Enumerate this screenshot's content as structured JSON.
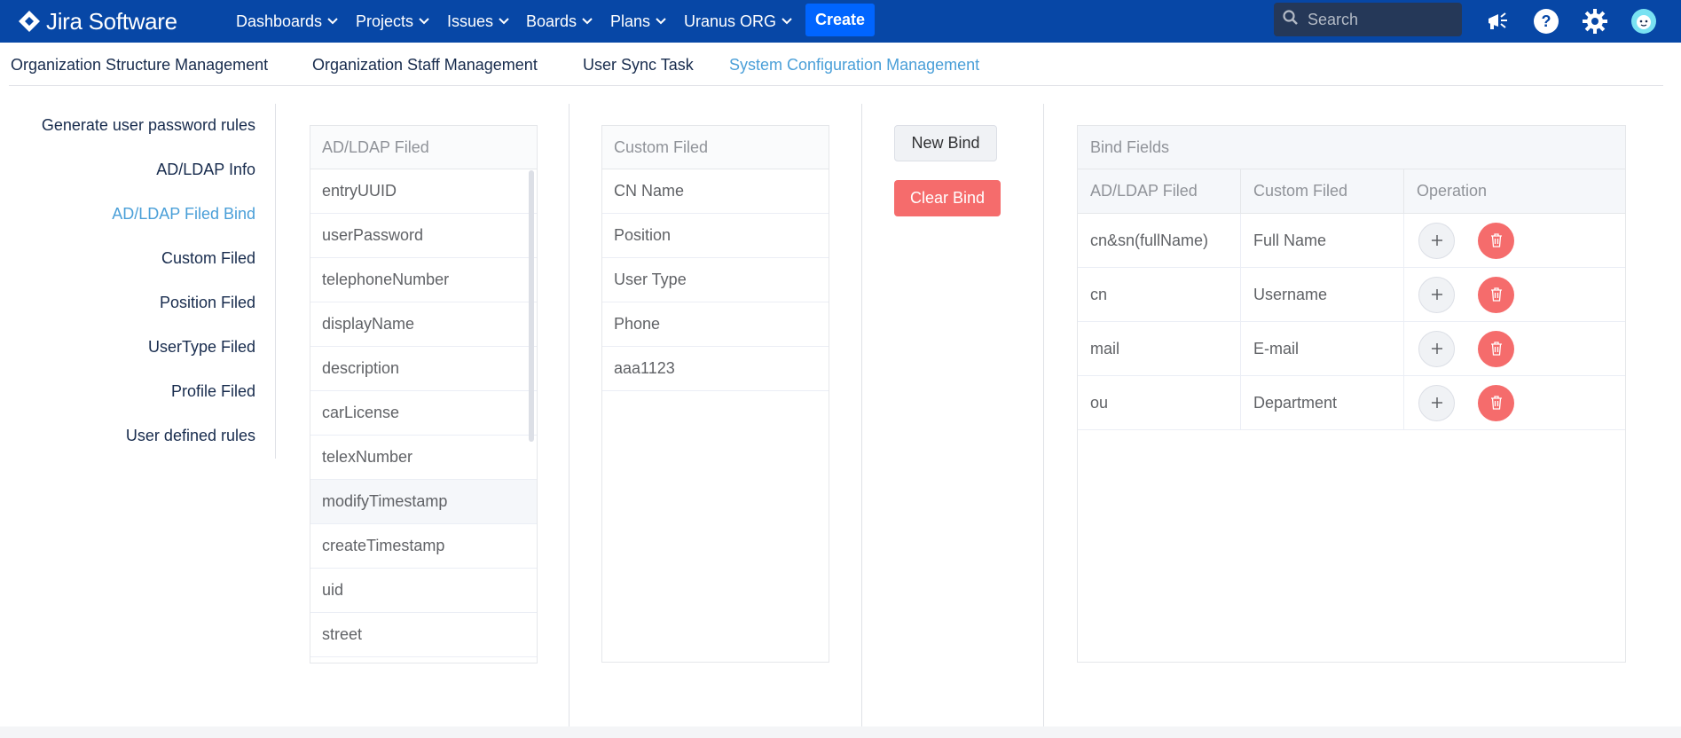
{
  "header": {
    "logo_text": "Jira Software",
    "nav": [
      {
        "label": "Dashboards"
      },
      {
        "label": "Projects"
      },
      {
        "label": "Issues"
      },
      {
        "label": "Boards"
      },
      {
        "label": "Plans"
      },
      {
        "label": "Uranus ORG"
      }
    ],
    "create_label": "Create",
    "search_placeholder": "Search"
  },
  "tabs": [
    {
      "label": "Organization Structure Management"
    },
    {
      "label": "Organization Staff Management"
    },
    {
      "label": "User Sync Task"
    },
    {
      "label": "System Configuration Management",
      "active": true
    }
  ],
  "sidebar": {
    "items": [
      {
        "label": "Generate user password rules"
      },
      {
        "label": "AD/LDAP Info"
      },
      {
        "label": "AD/LDAP Filed Bind",
        "active": true
      },
      {
        "label": "Custom Filed"
      },
      {
        "label": "Position Filed"
      },
      {
        "label": "UserType Filed"
      },
      {
        "label": "Profile Filed"
      },
      {
        "label": "User defined rules"
      }
    ]
  },
  "ldap_list": {
    "header": "AD/LDAP Filed",
    "items": [
      "entryUUID",
      "userPassword",
      "telephoneNumber",
      "displayName",
      "description",
      "carLicense",
      "telexNumber",
      "modifyTimestamp",
      "createTimestamp",
      "uid",
      "street"
    ]
  },
  "custom_list": {
    "header": "Custom Filed",
    "items": [
      "CN Name",
      "Position",
      "User Type",
      "Phone",
      "aaa1123"
    ]
  },
  "actions": {
    "new_bind": "New Bind",
    "clear_bind": "Clear Bind"
  },
  "bind_table": {
    "title": "Bind Fields",
    "columns": [
      "AD/LDAP Filed",
      "Custom Filed",
      "Operation"
    ],
    "rows": [
      {
        "ldap": "cn&sn(fullName)",
        "custom": "Full Name"
      },
      {
        "ldap": "cn",
        "custom": "Username"
      },
      {
        "ldap": "mail",
        "custom": "E-mail"
      },
      {
        "ldap": "ou",
        "custom": "Department"
      }
    ]
  },
  "colors": {
    "topbar": "#0747a6",
    "create": "#0065ff",
    "active_link": "#4a9fd8",
    "danger": "#f56c6c"
  }
}
